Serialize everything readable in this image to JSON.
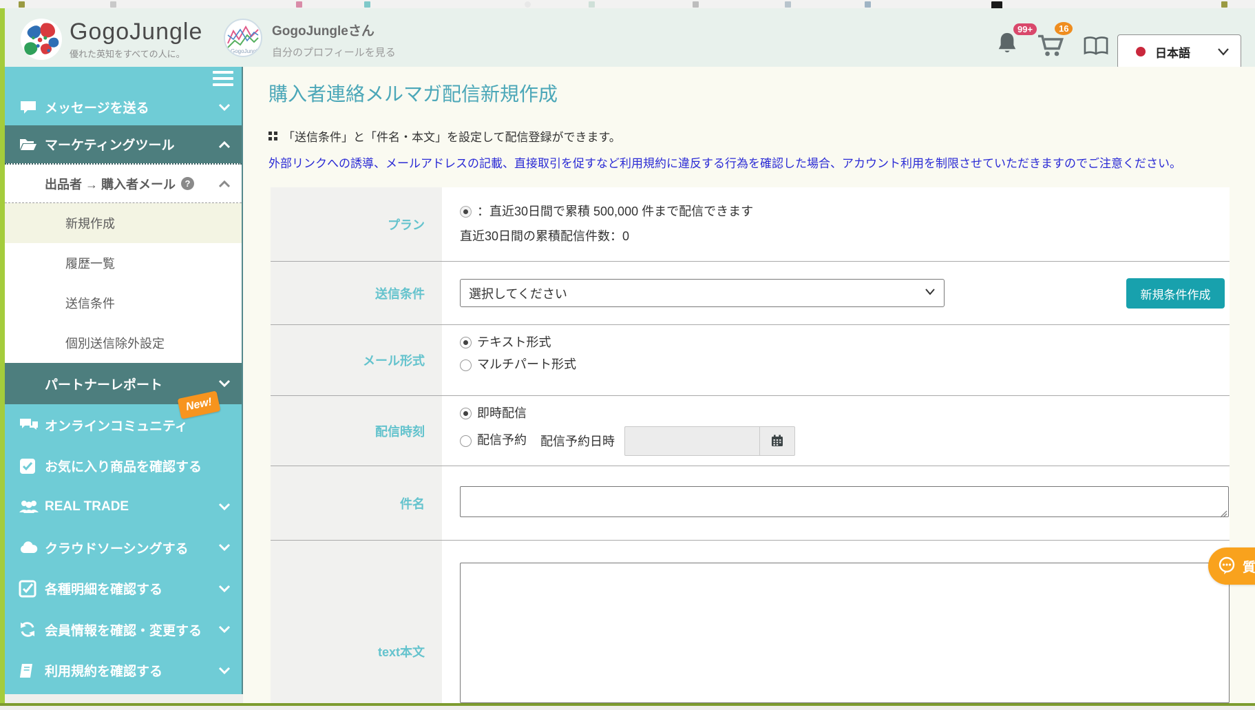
{
  "header": {
    "logo_text": "GogoJungle",
    "logo_tagline": "優れた英知をすべての人に。",
    "user_name": "GogoJungleさん",
    "profile_link": "自分のプロフィールを見る",
    "notification_badge": "99+",
    "cart_badge": "16",
    "language": "日本語"
  },
  "sidebar": {
    "items": [
      {
        "label": "メッセージを送る"
      },
      {
        "label": "マーケティングツール"
      },
      {
        "label": "出品者 → 購入者メール"
      },
      {
        "label": "新規作成"
      },
      {
        "label": "履歴一覧"
      },
      {
        "label": "送信条件"
      },
      {
        "label": "個別送信除外設定"
      },
      {
        "label": "パートナーレポート"
      },
      {
        "label": "オンラインコミュニティ",
        "badge": "New!"
      },
      {
        "label": "お気に入り商品を確認する"
      },
      {
        "label": "REAL TRADE"
      },
      {
        "label": "クラウドソーシングする"
      },
      {
        "label": "各種明細を確認する"
      },
      {
        "label": "会員情報を確認・変更する"
      },
      {
        "label": "利用規約を確認する"
      }
    ]
  },
  "main": {
    "title": "購入者連絡メルマガ配信新規作成",
    "subtitle": "「送信条件」と「件名・本文」を設定して配信登録ができます。",
    "warning": "外部リンクへの誘導、メールアドレスの記載、直接取引を促すなど利用規約に違反する行為を確認した場合、アカウント利用を制限させていただきますのでご注意ください。",
    "form": {
      "plan": {
        "label": "プラン",
        "limit_text": "：直近30日間で累積 500,000 件まで配信できます",
        "count_text": "直近30日間の累積配信件数：0"
      },
      "condition": {
        "label": "送信条件",
        "select_value": "選択してください",
        "create_button": "新規条件作成"
      },
      "format": {
        "label": "メール形式",
        "option1": "テキスト形式",
        "option2": "マルチパート形式"
      },
      "timing": {
        "label": "配信時刻",
        "option1": "即時配信",
        "option2": "配信予約",
        "datetime_label": "配信予約日時"
      },
      "subject": {
        "label": "件名"
      },
      "body": {
        "label": "text本文"
      }
    },
    "question_button": "質問"
  },
  "colors": {
    "accent_teal": "#18a1ad",
    "sidebar_teal": "#6fccd6",
    "sidebar_dark": "#4d7e7e",
    "warning_blue": "#2b2bd5",
    "badge_red": "#d9486b",
    "badge_orange": "#ef8d1f",
    "new_badge_orange": "#f7941e",
    "page_border_green": "#a4cc3c"
  }
}
